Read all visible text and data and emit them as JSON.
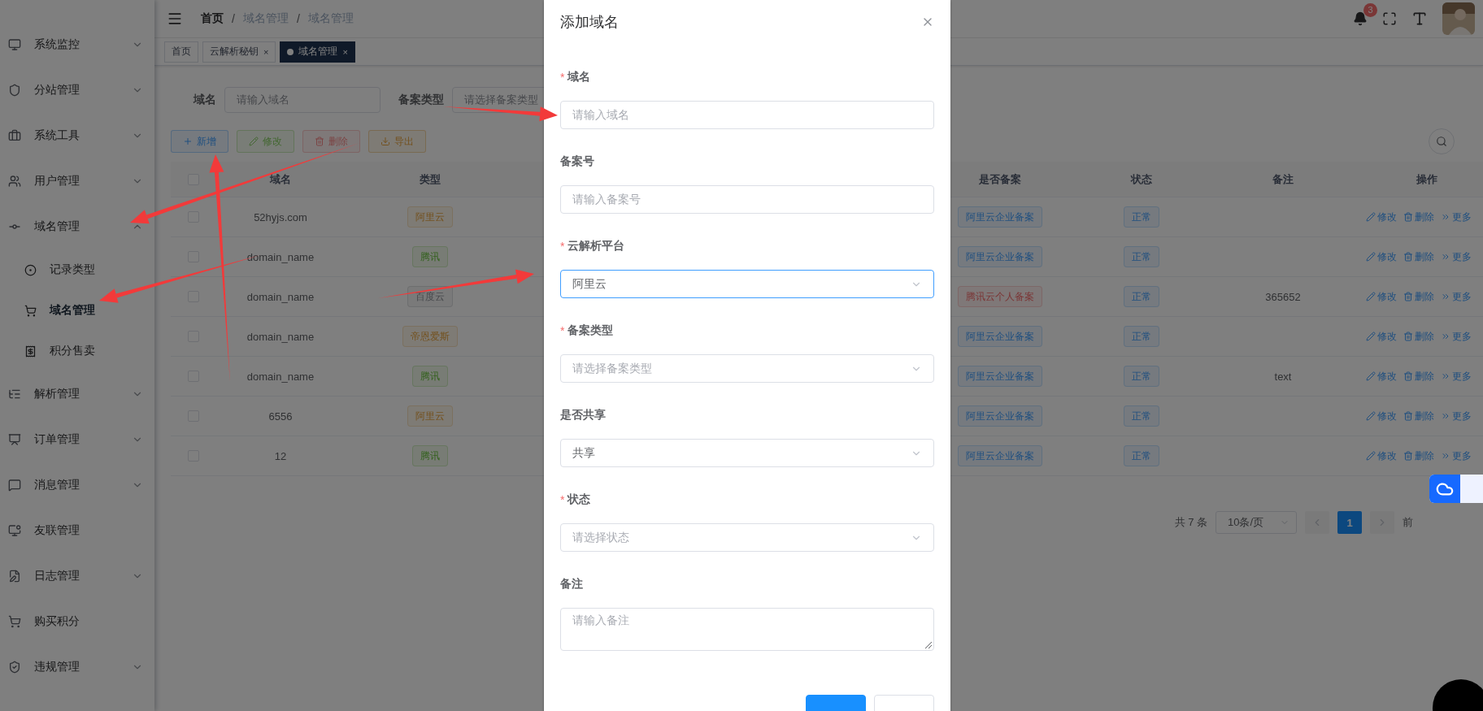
{
  "sidebar": {
    "items": [
      {
        "label": "系统监控",
        "kind": "menu",
        "expanded": false
      },
      {
        "label": "分站管理",
        "kind": "menu",
        "expanded": false
      },
      {
        "label": "系统工具",
        "kind": "menu",
        "expanded": false
      },
      {
        "label": "用户管理",
        "kind": "menu",
        "expanded": false
      },
      {
        "label": "域名管理",
        "kind": "menu",
        "expanded": true,
        "children": [
          {
            "label": "记录类型",
            "selected": false
          },
          {
            "label": "域名管理",
            "selected": true
          },
          {
            "label": "积分售卖",
            "selected": false
          }
        ]
      },
      {
        "label": "解析管理",
        "kind": "menu",
        "expanded": false
      },
      {
        "label": "订单管理",
        "kind": "menu",
        "expanded": false
      },
      {
        "label": "消息管理",
        "kind": "menu",
        "expanded": false
      },
      {
        "label": "友联管理",
        "kind": "link"
      },
      {
        "label": "日志管理",
        "kind": "menu",
        "expanded": false
      },
      {
        "label": "购买积分",
        "kind": "link"
      },
      {
        "label": "违规管理",
        "kind": "menu",
        "expanded": false
      }
    ]
  },
  "header": {
    "breadcrumb": [
      {
        "label": "首页",
        "kind": "link"
      },
      {
        "separator": "/",
        "label": "域名管理",
        "kind": "text"
      },
      {
        "separator": "/",
        "label": "域名管理",
        "kind": "text"
      }
    ],
    "notification_count": "3"
  },
  "tags": [
    {
      "label": "首页",
      "closable": false,
      "selected": false
    },
    {
      "label": "云解析秘钥",
      "closable": true,
      "selected": false,
      "close": "×"
    },
    {
      "label": "域名管理",
      "closable": true,
      "selected": true,
      "close": "×"
    }
  ],
  "search_form": [
    {
      "label": "域名",
      "placeholder": "请输入域名"
    },
    {
      "label": "备案类型",
      "placeholder": "请选择备案类型"
    }
  ],
  "toolbar": [
    {
      "label": "新增",
      "kind": "primary",
      "disabled": false
    },
    {
      "label": "修改",
      "kind": "success",
      "disabled": true
    },
    {
      "label": "删除",
      "kind": "danger",
      "disabled": true
    },
    {
      "label": "导出",
      "kind": "warning",
      "disabled": false
    }
  ],
  "table": {
    "all_checked": false,
    "columns": [
      "域名",
      "类型",
      "是否备案",
      "状态",
      "备注",
      "操作"
    ],
    "rows": [
      {
        "checked": false,
        "domain": "52hyjs.com",
        "type": {
          "label": "阿里云",
          "kind": "warning"
        },
        "filing": {
          "label": "阿里云企业备案",
          "kind": "primary"
        },
        "status": {
          "label": "正常",
          "kind": "primary"
        },
        "actions": [
          "修改",
          "删除",
          "更多"
        ]
      },
      {
        "checked": false,
        "domain": "domain_name",
        "type": {
          "label": "腾讯",
          "kind": "success"
        },
        "filing": {
          "label": "阿里云企业备案",
          "kind": "primary"
        },
        "status": {
          "label": "正常",
          "kind": "primary"
        },
        "actions": [
          "修改",
          "删除",
          "更多"
        ]
      },
      {
        "checked": false,
        "domain": "domain_name",
        "type": {
          "label": "百度云",
          "kind": "info"
        },
        "filing": {
          "label": "腾讯云个人备案",
          "kind": "danger"
        },
        "status": {
          "label": "正常",
          "kind": "primary"
        },
        "remark": "365652",
        "actions": [
          "修改",
          "删除",
          "更多"
        ]
      },
      {
        "checked": false,
        "domain": "domain_name",
        "type": {
          "label": "帝恩爱斯",
          "kind": "warning"
        },
        "filing": {
          "label": "阿里云企业备案",
          "kind": "primary"
        },
        "status": {
          "label": "正常",
          "kind": "primary"
        },
        "actions": [
          "修改",
          "删除",
          "更多"
        ]
      },
      {
        "checked": false,
        "domain": "domain_name",
        "type": {
          "label": "腾讯",
          "kind": "success"
        },
        "filing": {
          "label": "阿里云企业备案",
          "kind": "primary"
        },
        "status": {
          "label": "正常",
          "kind": "primary"
        },
        "remark": "text",
        "actions": [
          "修改",
          "删除",
          "更多"
        ]
      },
      {
        "checked": false,
        "domain": "6556",
        "type": {
          "label": "阿里云",
          "kind": "warning"
        },
        "filing": {
          "label": "阿里云企业备案",
          "kind": "primary"
        },
        "status": {
          "label": "正常",
          "kind": "primary"
        },
        "actions": [
          "修改",
          "删除",
          "更多"
        ]
      },
      {
        "checked": false,
        "domain": "12",
        "type": {
          "label": "腾讯",
          "kind": "success"
        },
        "filing": {
          "label": "阿里云企业备案",
          "kind": "primary"
        },
        "status": {
          "label": "正常",
          "kind": "primary"
        },
        "actions": [
          "修改",
          "删除",
          "更多"
        ]
      }
    ]
  },
  "pagination": {
    "total": "共 7 条",
    "page_size": "10条/页",
    "pages": [
      {
        "label": "1",
        "selected": true
      }
    ],
    "goto": "前"
  },
  "dialog": {
    "title": "添加域名",
    "fields": [
      {
        "label": "域名",
        "mark": "*",
        "kind": "input",
        "placeholder": "请输入域名",
        "focused": false
      },
      {
        "label": "备案号",
        "kind": "input",
        "placeholder": "请输入备案号",
        "focused": false
      },
      {
        "label": "云解析平台",
        "mark": "*",
        "kind": "select",
        "value": "阿里云",
        "focused": true
      },
      {
        "label": "备案类型",
        "mark": "*",
        "kind": "select",
        "placeholder": "请选择备案类型",
        "focused": false
      },
      {
        "label": "是否共享",
        "kind": "select",
        "value": "共享",
        "focused": false
      },
      {
        "label": "状态",
        "mark": "*",
        "kind": "select",
        "placeholder": "请选择状态",
        "focused": false
      },
      {
        "label": "备注",
        "kind": "textarea",
        "placeholder": "请输入备注",
        "focused": false
      }
    ],
    "buttons": [
      {
        "kind": "primary"
      },
      {
        "kind": "default"
      }
    ]
  }
}
